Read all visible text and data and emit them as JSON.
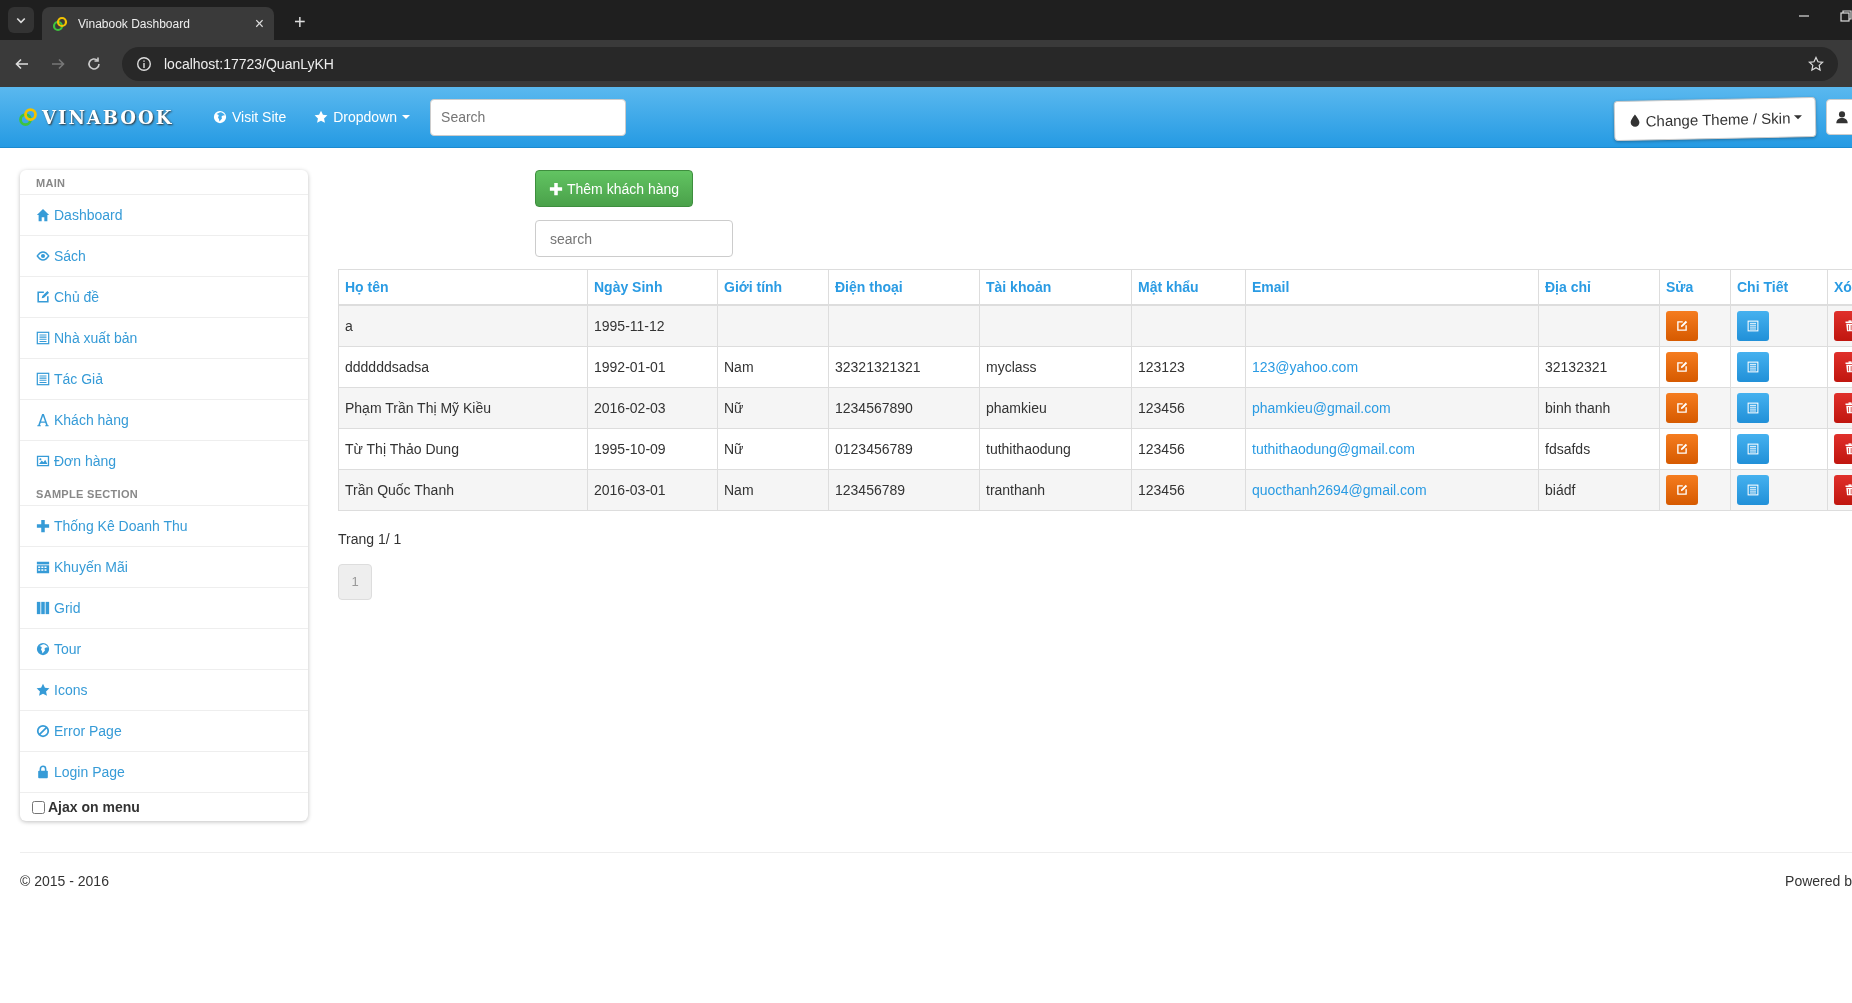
{
  "browser": {
    "tab_title": "Vinabook Dashboard",
    "close_tab": "×",
    "new_tab": "+",
    "url": "localhost:17723/QuanLyKH"
  },
  "navbar": {
    "brand": "VINABOOK",
    "links": [
      {
        "label": "Visit Site",
        "kind": "site"
      },
      {
        "label": "Dropdown",
        "kind": "dropdown"
      }
    ],
    "search": {
      "placeholder": "Search"
    },
    "theme_button": "Change Theme / Skin"
  },
  "sidebar": {
    "sections": [
      {
        "title": "MAIN",
        "items": [
          {
            "label": "Dashboard",
            "kind": "home"
          },
          {
            "label": "Sách",
            "kind": "eye"
          },
          {
            "label": "Chủ đề",
            "kind": "edit"
          },
          {
            "label": "Nhà xuất bản",
            "kind": "list"
          },
          {
            "label": "Tác Giả",
            "kind": "list"
          },
          {
            "label": "Khách hàng",
            "kind": "font"
          },
          {
            "label": "Đơn hàng",
            "kind": "picture"
          }
        ]
      },
      {
        "title": "SAMPLE SECTION",
        "items": [
          {
            "label": "Thống Kê Doanh Thu",
            "kind": "plus"
          },
          {
            "label": "Khuyến Mãi",
            "kind": "calendar"
          },
          {
            "label": "Grid",
            "kind": "grid"
          },
          {
            "label": "Tour",
            "kind": "globe"
          },
          {
            "label": "Icons",
            "kind": "star"
          },
          {
            "label": "Error Page",
            "kind": "ban"
          },
          {
            "label": "Login Page",
            "kind": "lock"
          }
        ]
      }
    ],
    "ajax_menu": {
      "label": "Ajax on menu",
      "checked": false
    }
  },
  "content": {
    "add_button": "Thêm khách hàng",
    "search": {
      "placeholder": "search"
    },
    "table": {
      "columns": [
        "Họ tên",
        "Ngày Sinh",
        "Giới tính",
        "Điện thoại",
        "Tài khoản",
        "Mật khẩu",
        "Email",
        "Địa chỉ",
        "Sửa",
        "Chi Tiết",
        "Xó"
      ],
      "rows": [
        {
          "name": "a",
          "birth_date": "1995-11-12"
        },
        {
          "name": "ddddddsadsa",
          "birth_date": "1992-01-01",
          "gender": "Nam",
          "phone": "32321321321",
          "account": "myclass",
          "password": "123123",
          "email": "123@yahoo.com",
          "address": "32132321"
        },
        {
          "name": "Phạm Trần Thị Mỹ Kiều",
          "birth_date": "2016-02-03",
          "gender": "Nữ",
          "phone": "1234567890",
          "account": "phamkieu",
          "password": "123456",
          "email": "phamkieu@gmail.com",
          "address": "binh thanh"
        },
        {
          "name": "Từ Thị Thảo Dung",
          "birth_date": "1995-10-09",
          "gender": "Nữ",
          "phone": "0123456789",
          "account": "tuthithaodung",
          "password": "123456",
          "email": "tuthithaodung@gmail.com",
          "address": "fdsafds"
        },
        {
          "name": "Trần Quốc Thanh",
          "birth_date": "2016-03-01",
          "gender": "Nam",
          "phone": "123456789",
          "account": "tranthanh",
          "password": "123456",
          "email": "quocthanh2694@gmail.com",
          "address": "biádf"
        }
      ]
    },
    "page_info": "Trang 1/ 1",
    "pages": [
      {
        "label": "1",
        "selected": true
      }
    ]
  },
  "footer": {
    "copyright": "© 2015 - 2016",
    "powered": "Powered b"
  }
}
